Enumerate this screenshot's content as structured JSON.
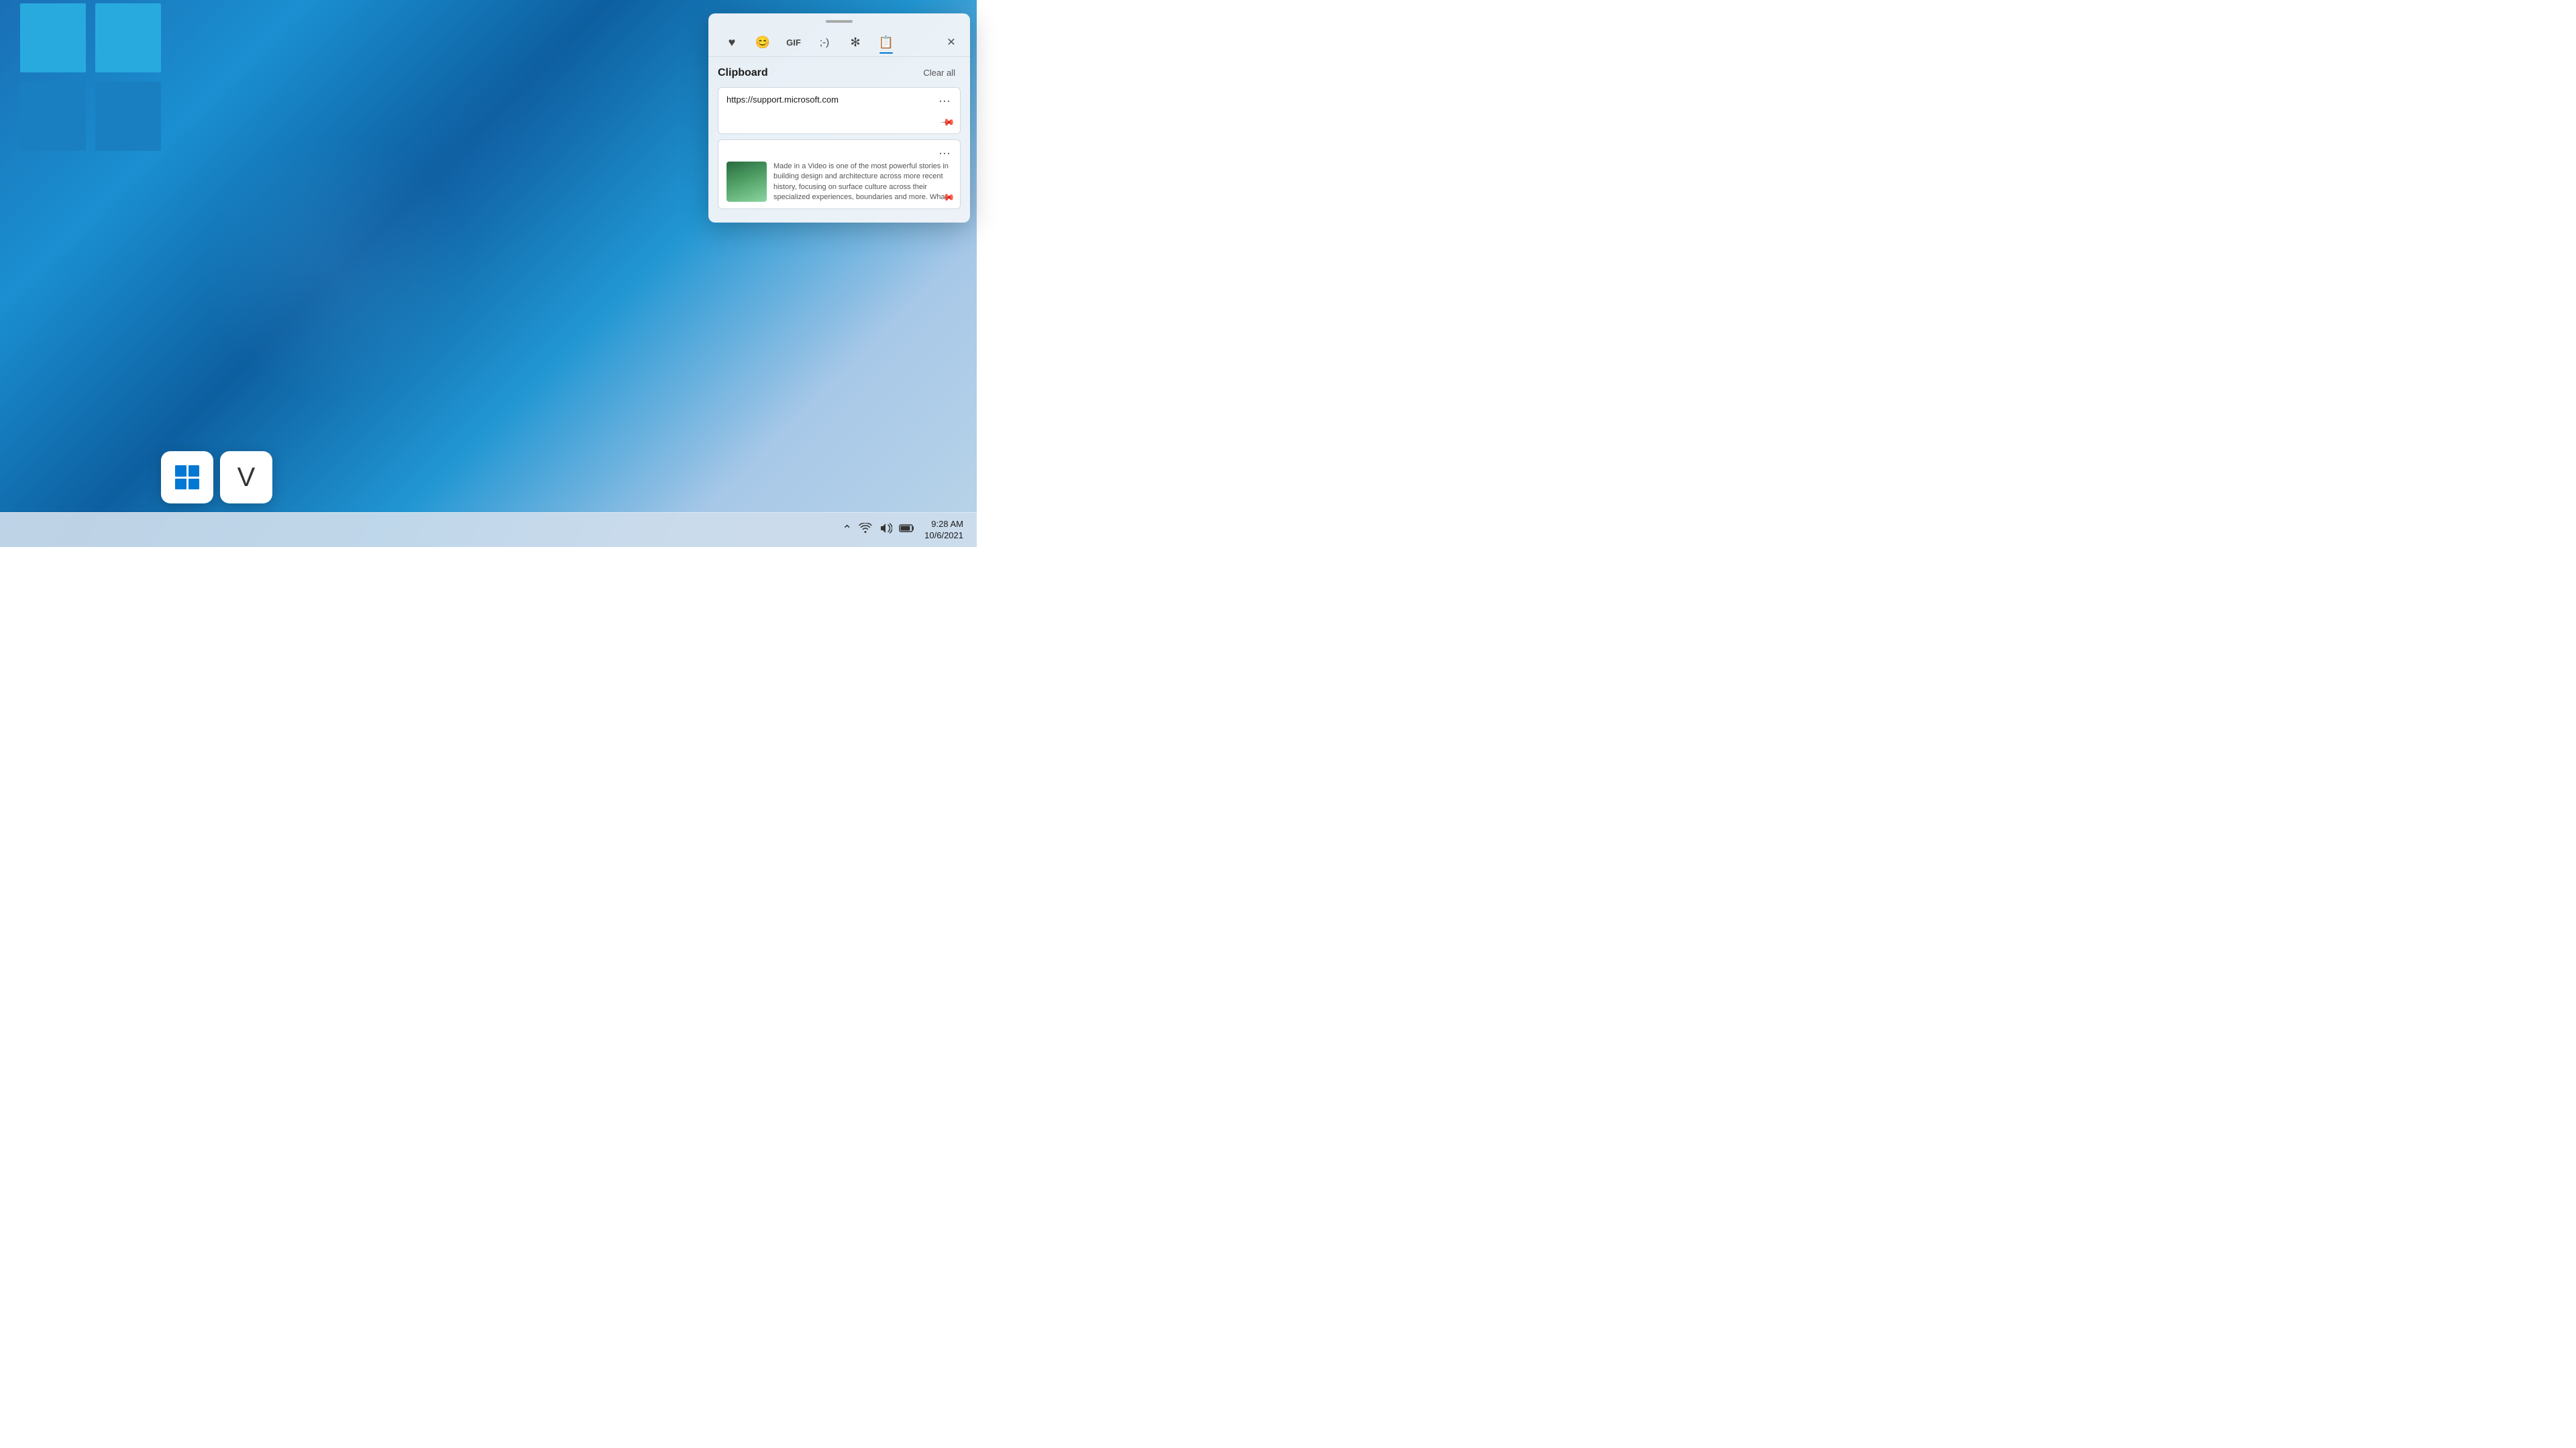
{
  "desktop": {
    "background_description": "Windows 11 blue swirl wallpaper"
  },
  "shortcut_popup": {
    "win_key_label": "⊞",
    "v_key_label": "V",
    "description": "Win+V clipboard shortcut"
  },
  "clipboard_panel": {
    "drag_handle_label": "drag handle",
    "close_button_label": "✕",
    "tabs": [
      {
        "id": "emoji",
        "icon": "♥",
        "label": "Emoji",
        "active": false
      },
      {
        "id": "kaomoji",
        "icon": "😊",
        "label": "Kaomoji",
        "active": false
      },
      {
        "id": "gif",
        "icon": "GIF",
        "label": "GIF",
        "active": false
      },
      {
        "id": "symbols",
        "icon": ";-)",
        "label": "Symbols",
        "active": false
      },
      {
        "id": "special",
        "icon": "✻",
        "label": "Special",
        "active": false
      },
      {
        "id": "clipboard",
        "icon": "📋",
        "label": "Clipboard",
        "active": true
      }
    ],
    "section_title": "Clipboard",
    "clear_all_label": "Clear all",
    "items": [
      {
        "id": "item1",
        "type": "text",
        "content": "https://support.microsoft.com",
        "pinned": false
      },
      {
        "id": "item2",
        "type": "image",
        "thumbnail_alt": "Article with building image",
        "text_preview": "Made in a Video is one of the most powerful stories in building design and architecture across more recent history, focusing on surface culture across their specialized experiences, boundaries and more. What bright, Sea eyes...",
        "pinned": false
      }
    ]
  },
  "taskbar": {
    "system_tray": {
      "chevron_label": "^",
      "wifi_label": "WiFi",
      "volume_label": "Volume",
      "battery_label": "Battery"
    },
    "datetime": {
      "time": "9:28 AM",
      "date": "10/6/2021"
    }
  }
}
